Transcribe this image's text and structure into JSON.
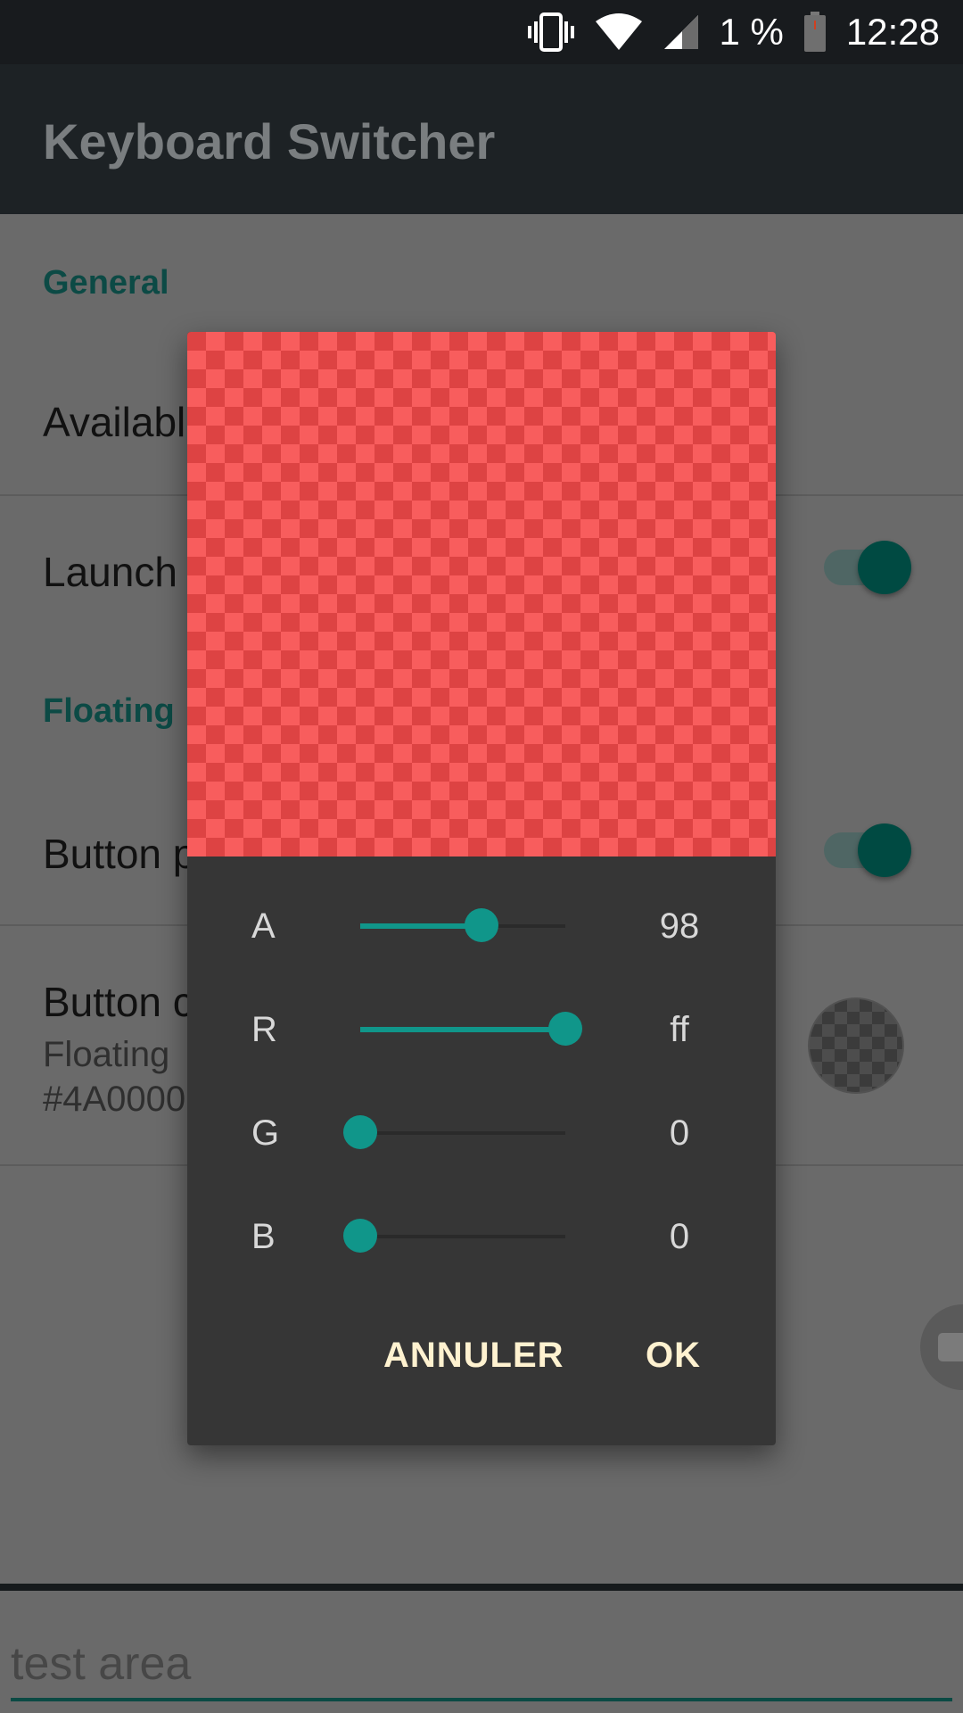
{
  "status_bar": {
    "battery_percent": "1 %",
    "time": "12:28"
  },
  "app_bar": {
    "title": "Keyboard Switcher"
  },
  "settings": {
    "section_general": "General",
    "pref_available": "Availabl",
    "pref_launch": "Launch",
    "pref_launch_enabled": true,
    "section_floating": "Floating",
    "pref_button_p": "Button p",
    "pref_button_p_enabled": true,
    "pref_button_color_title": "Button c",
    "pref_button_color_sub1": "Floating",
    "pref_button_color_sub2": "#4A0000"
  },
  "test_area": {
    "placeholder": "test area"
  },
  "color_dialog": {
    "preview_color": "#ff0000",
    "channels": [
      {
        "label": "A",
        "value": "98",
        "fraction": 0.59
      },
      {
        "label": "R",
        "value": "ff",
        "fraction": 1.0
      },
      {
        "label": "G",
        "value": "0",
        "fraction": 0.0
      },
      {
        "label": "B",
        "value": "0",
        "fraction": 0.0
      }
    ],
    "cancel_label": "ANNULER",
    "ok_label": "OK"
  },
  "colors": {
    "accent": "#10968a",
    "button_text": "#fff2d0",
    "dialog_background": "#363636"
  },
  "icons": {
    "vibrate": "vibrate-icon",
    "wifi": "wifi-icon",
    "signal": "signal-icon",
    "battery": "battery-icon",
    "keyboard": "keyboard-icon"
  }
}
